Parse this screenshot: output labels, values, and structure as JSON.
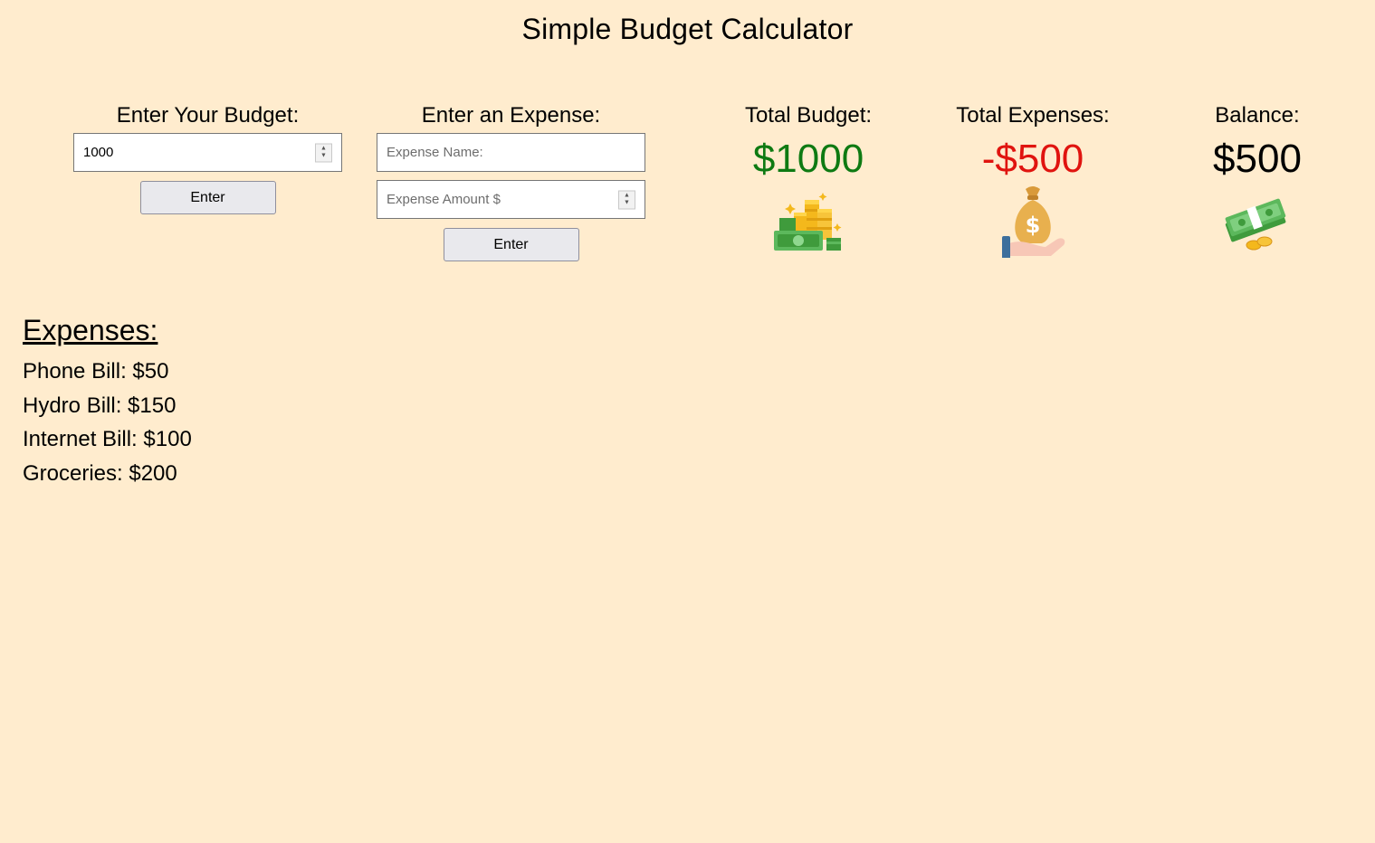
{
  "header": {
    "title": "Simple Budget Calculator"
  },
  "budget_form": {
    "label": "Enter Your Budget:",
    "value": "1000",
    "button_label": "Enter"
  },
  "expense_form": {
    "label": "Enter an Expense:",
    "name_placeholder": "Expense Name:",
    "amount_placeholder": "Expense Amount $",
    "button_label": "Enter"
  },
  "summary": {
    "total_budget": {
      "label": "Total Budget:",
      "value": "$1000",
      "color": "#0e7a12",
      "icon": "money-coins-icon"
    },
    "total_expenses": {
      "label": "Total Expenses:",
      "value": "-$500",
      "color": "#e0140f",
      "icon": "money-bag-hand-icon"
    },
    "balance": {
      "label": "Balance:",
      "value": "$500",
      "color": "#000000",
      "icon": "cash-stack-icon"
    }
  },
  "expenses": {
    "title": "Expenses:",
    "items": [
      {
        "text": "Phone Bill: $50"
      },
      {
        "text": "Hydro Bill: $150"
      },
      {
        "text": "Internet Bill: $100"
      },
      {
        "text": "Groceries: $200"
      }
    ]
  },
  "colors": {
    "background": "#ffecce"
  }
}
